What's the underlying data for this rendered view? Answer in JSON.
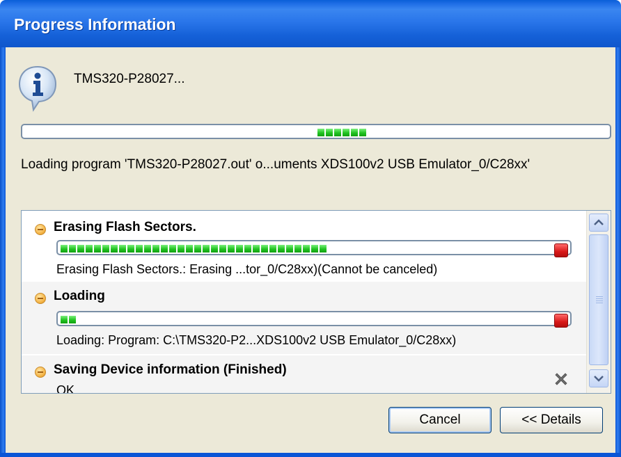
{
  "window": {
    "title": "Progress Information"
  },
  "header": {
    "label": "TMS320-P28027..."
  },
  "main_progress": {
    "active_segments": 6
  },
  "status": {
    "text": "Loading program 'TMS320-P28027.out' o...uments XDS100v2 USB Emulator_0/C28xx'"
  },
  "jobs": [
    {
      "title": "Erasing Flash Sectors.",
      "detail": "Erasing Flash Sectors.:  Erasing ...tor_0/C28xx)(Cannot be canceled)",
      "progress": 0.52
    },
    {
      "title": "Loading",
      "detail": "Loading: Program: C:\\TMS320-P2...XDS100v2 USB Emulator_0/C28xx)",
      "progress": 0.04
    },
    {
      "title": "Saving Device information (Finished)",
      "detail": "OK"
    }
  ],
  "buttons": {
    "cancel": "Cancel",
    "details": "<< Details"
  },
  "colors": {
    "titlebar": "#1f6ee6",
    "progress_fill": "#22c322",
    "stop": "#d81818"
  }
}
